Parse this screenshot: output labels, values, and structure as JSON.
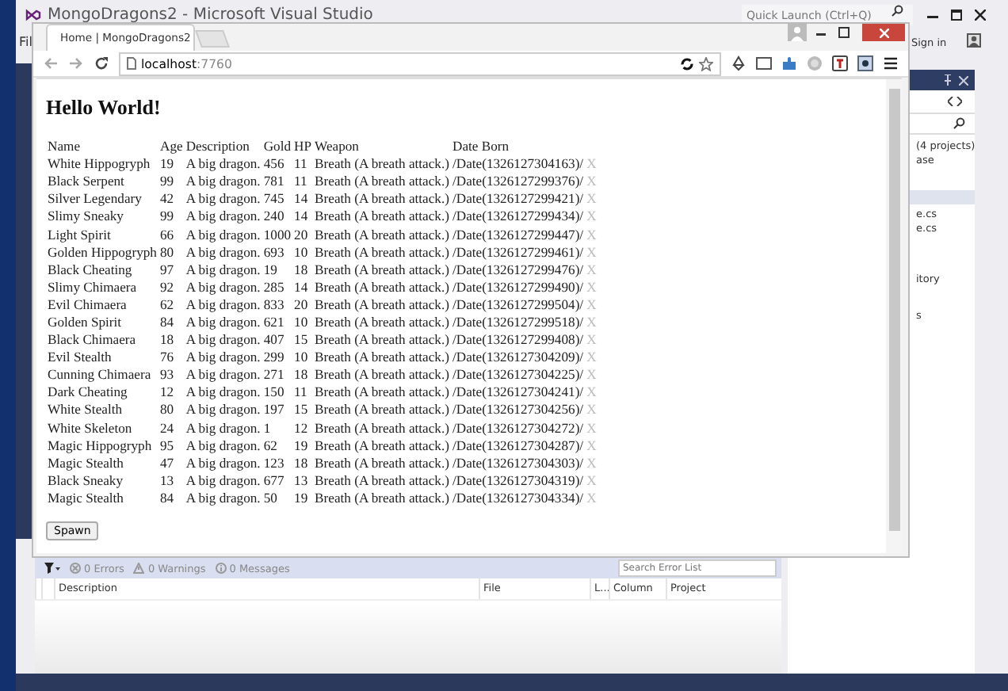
{
  "vs": {
    "title": "MongoDragons2 - Microsoft Visual Studio",
    "quick_launch": {
      "placeholder": "Quick Launch (Ctrl+Q)"
    },
    "menu_fragment": "Fil",
    "sign_in": "Sign in",
    "error_list": {
      "filters": [
        {
          "kind": "error",
          "label": "0 Errors"
        },
        {
          "kind": "warning",
          "label": "0 Warnings"
        },
        {
          "kind": "message",
          "label": "0 Messages"
        }
      ],
      "search": {
        "placeholder": "Search Error List"
      },
      "columns": [
        "Description",
        "File",
        "L...",
        "Column",
        "Project"
      ]
    },
    "solution_fragments": [
      "(4 projects)",
      "ase",
      "e.cs",
      "e.cs",
      "itory",
      "s"
    ]
  },
  "browser": {
    "tab": {
      "title": "Home | MongoDragons2"
    },
    "address": {
      "host": "localhost",
      "port": ":7760"
    },
    "page": {
      "heading": "Hello World!",
      "table": {
        "columns": [
          "Name",
          "Age",
          "Description",
          "Gold",
          "HP",
          "Weapon",
          "Date Born"
        ],
        "rows": [
          [
            "White Hippogryph",
            "19",
            "A big dragon.",
            "456",
            "11",
            "Breath (A breath attack.)",
            "/Date(1326127304163)/",
            "X"
          ],
          [
            "Black Serpent",
            "99",
            "A big dragon.",
            "781",
            "11",
            "Breath (A breath attack.)",
            "/Date(1326127299376)/",
            "X"
          ],
          [
            "Silver Legendary",
            "42",
            "A big dragon.",
            "745",
            "14",
            "Breath (A breath attack.)",
            "/Date(1326127299421)/",
            "X"
          ],
          [
            "Slimy Sneaky",
            "99",
            "A big dragon.",
            "240",
            "14",
            "Breath (A breath attack.)",
            "/Date(1326127299434)/",
            "X"
          ],
          [
            "Light Spirit",
            "66",
            "A big dragon.",
            "1000",
            "20",
            "Breath (A breath attack.)",
            "/Date(1326127299447)/",
            "X"
          ],
          [
            "Golden Hippogryph",
            "80",
            "A big dragon.",
            "693",
            "10",
            "Breath (A breath attack.)",
            "/Date(1326127299461)/",
            "X"
          ],
          [
            "Black Cheating",
            "97",
            "A big dragon.",
            "19",
            "18",
            "Breath (A breath attack.)",
            "/Date(1326127299476)/",
            "X"
          ],
          [
            "Slimy Chimaera",
            "92",
            "A big dragon.",
            "285",
            "14",
            "Breath (A breath attack.)",
            "/Date(1326127299490)/",
            "X"
          ],
          [
            "Evil Chimaera",
            "62",
            "A big dragon.",
            "833",
            "20",
            "Breath (A breath attack.)",
            "/Date(1326127299504)/",
            "X"
          ],
          [
            "Golden Spirit",
            "84",
            "A big dragon.",
            "621",
            "10",
            "Breath (A breath attack.)",
            "/Date(1326127299518)/",
            "X"
          ],
          [
            "Black Chimaera",
            "18",
            "A big dragon.",
            "407",
            "15",
            "Breath (A breath attack.)",
            "/Date(1326127299408)/",
            "X"
          ],
          [
            "Evil Stealth",
            "76",
            "A big dragon.",
            "299",
            "10",
            "Breath (A breath attack.)",
            "/Date(1326127304209)/",
            "X"
          ],
          [
            "Cunning Chimaera",
            "93",
            "A big dragon.",
            "271",
            "18",
            "Breath (A breath attack.)",
            "/Date(1326127304225)/",
            "X"
          ],
          [
            "Dark Cheating",
            "12",
            "A big dragon.",
            "150",
            "11",
            "Breath (A breath attack.)",
            "/Date(1326127304241)/",
            "X"
          ],
          [
            "White Stealth",
            "80",
            "A big dragon.",
            "197",
            "15",
            "Breath (A breath attack.)",
            "/Date(1326127304256)/",
            "X"
          ],
          [
            "White Skeleton",
            "24",
            "A big dragon.",
            "1",
            "12",
            "Breath (A breath attack.)",
            "/Date(1326127304272)/",
            "X"
          ],
          [
            "Magic Hippogryph",
            "95",
            "A big dragon.",
            "62",
            "19",
            "Breath (A breath attack.)",
            "/Date(1326127304287)/",
            "X"
          ],
          [
            "Magic Stealth",
            "47",
            "A big dragon.",
            "123",
            "18",
            "Breath (A breath attack.)",
            "/Date(1326127304303)/",
            "X"
          ],
          [
            "Black Sneaky",
            "13",
            "A big dragon.",
            "677",
            "13",
            "Breath (A breath attack.)",
            "/Date(1326127304319)/",
            "X"
          ],
          [
            "Magic Stealth",
            "84",
            "A big dragon.",
            "50",
            "19",
            "Breath (A breath attack.)",
            "/Date(1326127304334)/",
            "X"
          ]
        ]
      },
      "button": "Spawn"
    }
  }
}
